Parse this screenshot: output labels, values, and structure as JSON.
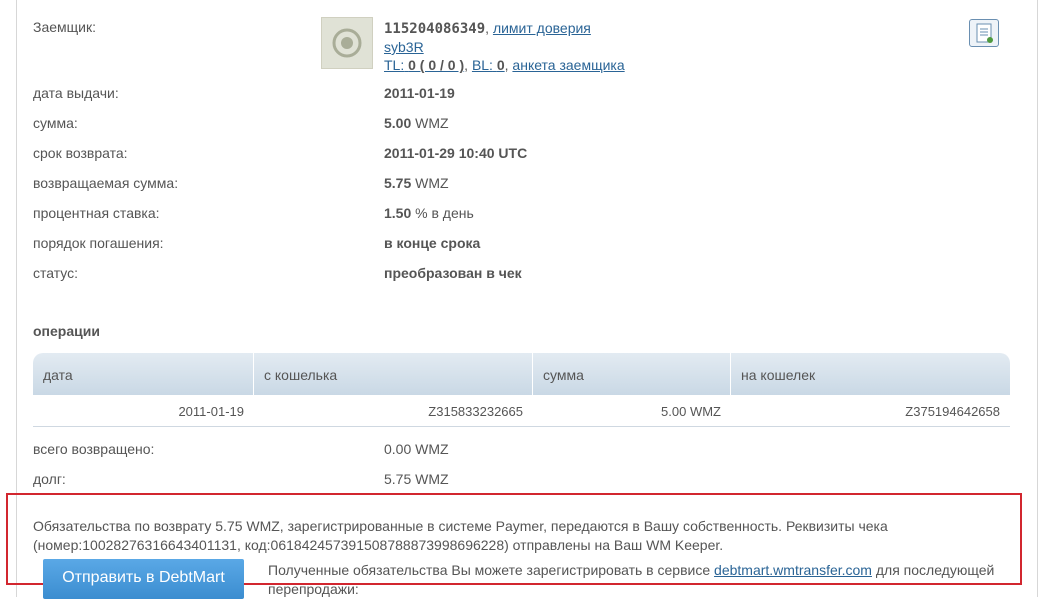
{
  "borrower": {
    "label": "Заемщик:",
    "wmid": "115204086349",
    "sep1": ", ",
    "trust_limit": "лимит доверия",
    "nick": "syb3R",
    "tl_prefix": "TL:",
    "tl_value": "0 ( 0 / 0 )",
    "sep2": ", ",
    "bl_prefix": "BL:",
    "bl_value": "0",
    "sep3": ", ",
    "profile": "анкета заемщика"
  },
  "details": [
    {
      "label": "дата выдачи:",
      "value": "2011-01-19",
      "unit": ""
    },
    {
      "label": "сумма:",
      "value": "5.00",
      "unit": "WMZ"
    },
    {
      "label": "срок возврата:",
      "value": "2011-01-29 10:40 UTC",
      "unit": ""
    },
    {
      "label": "возвращаемая сумма:",
      "value": "5.75",
      "unit": "WMZ"
    },
    {
      "label": "процентная ставка:",
      "value": "1.50",
      "unit": "% в день"
    },
    {
      "label": "порядок погашения:",
      "value": "в конце срока",
      "unit": ""
    },
    {
      "label": "статус:",
      "value": "преобразован в чек",
      "unit": ""
    }
  ],
  "operations": {
    "title": "операции",
    "headers": [
      "дата",
      "с кошелька",
      "сумма",
      "на кошелек"
    ],
    "rows": [
      [
        "2011-01-19",
        "Z315833232665",
        "5.00 WMZ",
        "Z375194642658"
      ]
    ]
  },
  "totals": [
    {
      "label": "всего возвращено:",
      "value": "0.00 WMZ"
    },
    {
      "label": "долг:",
      "value": "5.75 WMZ"
    }
  ],
  "notice": {
    "text": "Обязательства по возврату 5.75 WMZ, зарегистрированные в системе Paymer, передаются в Вашу собственность. Реквизиты чека (номер:10028276316643401131, код:06184245739150878887399869622​8) отправлены на Ваш WM Keeper.",
    "button": "Отправить в DebtMart",
    "register_prefix": "Полученные обязательства Вы можете зарегистрировать в сервисе",
    "register_link": "debtmart.wmtransfer.com",
    "register_suffix": "для последующей перепродажи:",
    "border_color": "#d2262f"
  }
}
